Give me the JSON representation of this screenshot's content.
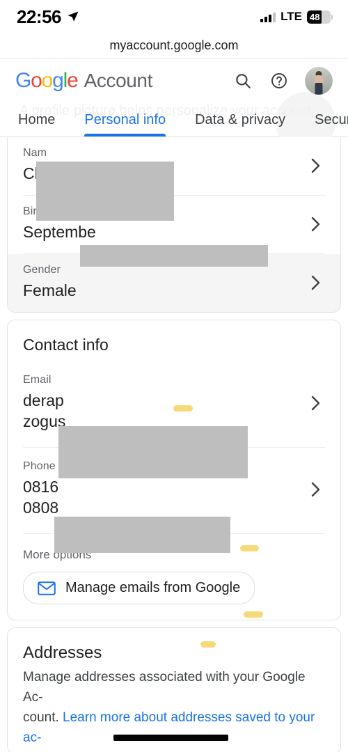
{
  "statusbar": {
    "time": "22:56",
    "location_icon": "location-arrow-icon",
    "network": "LTE",
    "battery_percent": "48"
  },
  "browser": {
    "url": "myaccount.google.com"
  },
  "header": {
    "logo_g": "G",
    "logo_o1": "o",
    "logo_o2": "o",
    "logo_g2": "g",
    "logo_l": "l",
    "logo_e": "e",
    "product": "Account",
    "search_icon": "search-icon",
    "help_icon": "help-circle-icon",
    "avatar": "user-avatar",
    "ghost_text": "A profile picture helps personalize your account"
  },
  "tabs": [
    {
      "label": "Home",
      "active": false
    },
    {
      "label": "Personal info",
      "active": true
    },
    {
      "label": "Data & privacy",
      "active": false
    },
    {
      "label": "Security",
      "active": false
    }
  ],
  "basic_info": {
    "rows": [
      {
        "label": "Nam",
        "value": "Ch",
        "redacted": true
      },
      {
        "label": "Birthday",
        "value": "Septembe",
        "redacted": true
      },
      {
        "label": "Gender",
        "value": "Female",
        "redacted": false,
        "hovered": true
      }
    ]
  },
  "contact_info": {
    "title": "Contact info",
    "email": {
      "label": "Email",
      "value_line1": "derap",
      "value_line2": "zogus"
    },
    "phone": {
      "label": "Phone",
      "value_line1": "0816",
      "value_line2": "0808"
    },
    "more_options_label": "More options",
    "manage_emails_button": "Manage emails from Google",
    "manage_emails_icon": "envelope-icon"
  },
  "addresses": {
    "title": "Addresses",
    "desc_part1": "Manage addresses associated with your Google Ac-",
    "desc_part2": "count. ",
    "link_text": "Learn more about addresses saved to your ac-"
  },
  "colors": {
    "accent_blue": "#1a73e8",
    "google_blue": "#4285F4",
    "google_red": "#EA4335",
    "google_yellow": "#FBBC05",
    "google_green": "#34A853",
    "highlighter_yellow": "#f6d772",
    "redaction_gray": "#bebebe"
  }
}
